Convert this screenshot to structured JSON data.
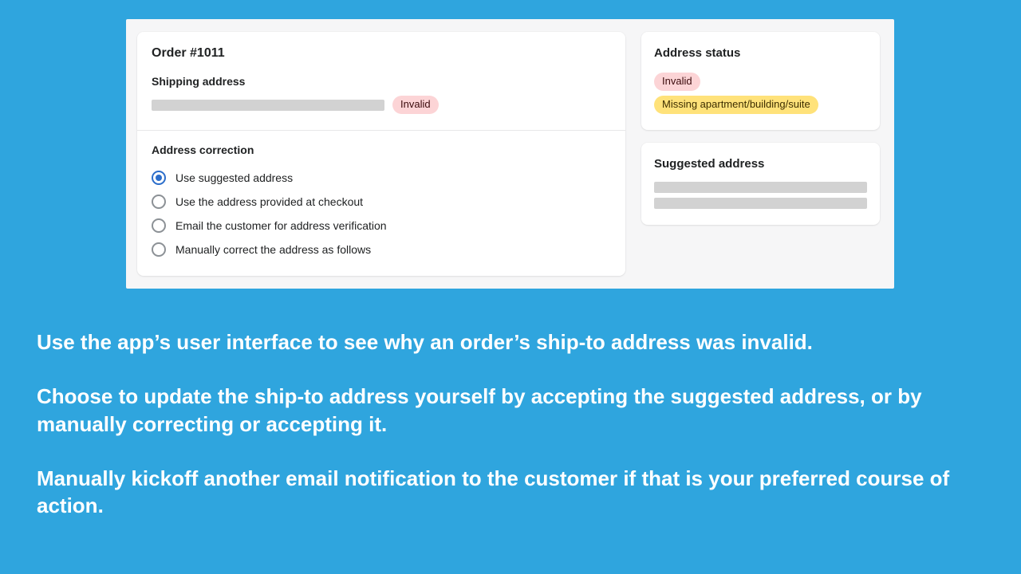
{
  "order": {
    "title": "Order #1011",
    "shipping_label": "Shipping address",
    "shipping_badge": "Invalid"
  },
  "correction": {
    "title": "Address correction",
    "options": [
      {
        "label": "Use suggested address",
        "selected": true
      },
      {
        "label": "Use the address provided at checkout",
        "selected": false
      },
      {
        "label": "Email the customer for address verification",
        "selected": false
      },
      {
        "label": "Manually correct the address as follows",
        "selected": false
      }
    ]
  },
  "address_status": {
    "title": "Address status",
    "badges": [
      {
        "text": "Invalid",
        "variant": "pink"
      },
      {
        "text": "Missing apartment/building/suite",
        "variant": "yellow"
      }
    ]
  },
  "suggested": {
    "title": "Suggested address"
  },
  "marketing": {
    "p1": "Use the app’s user interface to see why an order’s ship-to address was invalid.",
    "p2": "Choose to update the ship-to address yourself by accepting the suggested address, or by manually correcting or accepting it.",
    "p3": "Manually kickoff another email notification to the customer if that is your preferred course of action."
  },
  "colors": {
    "bg": "#2fa5de",
    "badge_pink": "#fcd4d6",
    "badge_yellow": "#ffe27a",
    "accent": "#2c6ecb"
  }
}
